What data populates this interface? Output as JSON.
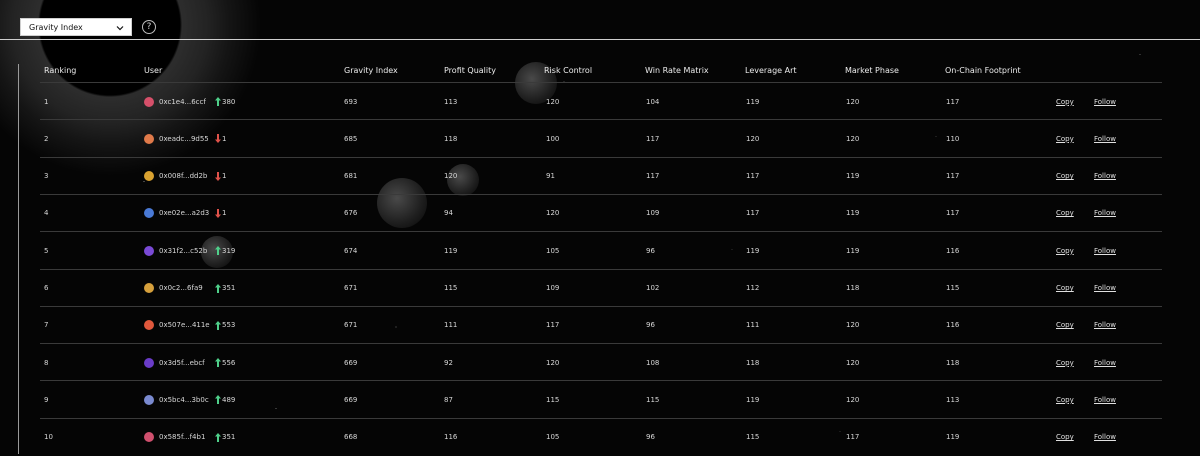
{
  "selector": {
    "value": "Gravity Index",
    "help_symbol": "?"
  },
  "columns": [
    "Ranking",
    "User",
    "Gravity Index",
    "Profit Quality",
    "Risk Control",
    "Win Rate Matrix",
    "Leverage Art",
    "Market Phase",
    "On-Chain Footprint"
  ],
  "actions": {
    "copy": "Copy",
    "follow": "Follow"
  },
  "rows": [
    {
      "rank": "1",
      "user": "0xc1e4...6ccf",
      "avatar_color": "#d6506a",
      "dir": "up",
      "change": "380",
      "gravity": "693",
      "profit": "113",
      "risk": "120",
      "winrate": "104",
      "leverage": "119",
      "phase": "120",
      "onchain": "117"
    },
    {
      "rank": "2",
      "user": "0xeadc...9d55",
      "avatar_color": "#e07a4a",
      "dir": "down",
      "change": "1",
      "gravity": "685",
      "profit": "118",
      "risk": "100",
      "winrate": "117",
      "leverage": "120",
      "phase": "120",
      "onchain": "110"
    },
    {
      "rank": "3",
      "user": "0x008f...dd2b",
      "avatar_color": "#d9a230",
      "dir": "down",
      "change": "1",
      "gravity": "681",
      "profit": "120",
      "risk": "91",
      "winrate": "117",
      "leverage": "117",
      "phase": "119",
      "onchain": "117"
    },
    {
      "rank": "4",
      "user": "0xe02e...a2d3",
      "avatar_color": "#4a7ad6",
      "dir": "down",
      "change": "1",
      "gravity": "676",
      "profit": "94",
      "risk": "120",
      "winrate": "109",
      "leverage": "117",
      "phase": "119",
      "onchain": "117"
    },
    {
      "rank": "5",
      "user": "0x31f2...c52b",
      "avatar_color": "#7a4ad6",
      "dir": "up",
      "change": "319",
      "gravity": "674",
      "profit": "119",
      "risk": "105",
      "winrate": "96",
      "leverage": "119",
      "phase": "119",
      "onchain": "116"
    },
    {
      "rank": "6",
      "user": "0x0c2...6fa9",
      "avatar_color": "#d6a03c",
      "dir": "up",
      "change": "351",
      "gravity": "671",
      "profit": "115",
      "risk": "109",
      "winrate": "102",
      "leverage": "112",
      "phase": "118",
      "onchain": "115"
    },
    {
      "rank": "7",
      "user": "0x507e...411e",
      "avatar_color": "#e0583c",
      "dir": "up",
      "change": "553",
      "gravity": "671",
      "profit": "111",
      "risk": "117",
      "winrate": "96",
      "leverage": "111",
      "phase": "120",
      "onchain": "116"
    },
    {
      "rank": "8",
      "user": "0x3d5f...ebcf",
      "avatar_color": "#6a3cc8",
      "dir": "up",
      "change": "556",
      "gravity": "669",
      "profit": "92",
      "risk": "120",
      "winrate": "108",
      "leverage": "118",
      "phase": "120",
      "onchain": "118"
    },
    {
      "rank": "9",
      "user": "0x5bc4...3b0c",
      "avatar_color": "#7a8ad0",
      "dir": "up",
      "change": "489",
      "gravity": "669",
      "profit": "87",
      "risk": "115",
      "winrate": "115",
      "leverage": "119",
      "phase": "120",
      "onchain": "113"
    },
    {
      "rank": "10",
      "user": "0x585f...f4b1",
      "avatar_color": "#d0506e",
      "dir": "up",
      "change": "351",
      "gravity": "668",
      "profit": "116",
      "risk": "105",
      "winrate": "96",
      "leverage": "115",
      "phase": "117",
      "onchain": "119"
    }
  ],
  "colors": {
    "up": "#4fd08a",
    "down": "#e0524a",
    "divider": "#3a3a3a"
  }
}
